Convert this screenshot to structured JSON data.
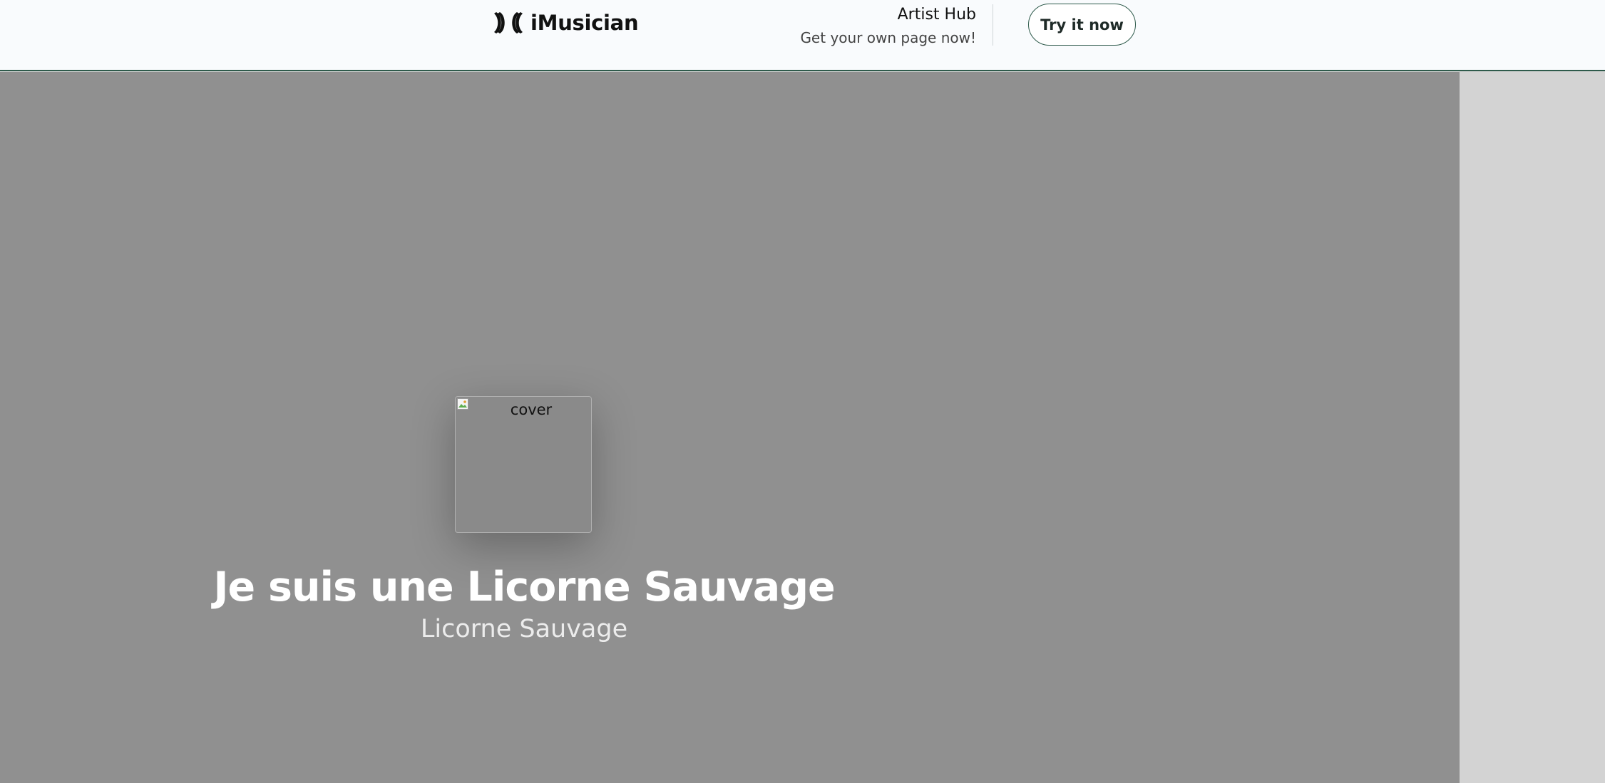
{
  "header": {
    "brand_name": "iMusician",
    "hub_title": "Artist Hub",
    "hub_subtitle": "Get your own page now!",
    "cta_label": "Try it now"
  },
  "release": {
    "cover_alt": "cover",
    "title": "Je suis une Licorne Sauvage",
    "artist": "Licorne Sauvage"
  },
  "icons": {
    "brand_logo": "imusician-logo-icon",
    "broken_image": "broken-image-icon"
  },
  "colors": {
    "header_bg": "#f9fbfd",
    "accent": "#2e5a4b",
    "hero_bg": "#909090",
    "side_bg": "#d3d3d3",
    "title_text": "#ffffff"
  }
}
